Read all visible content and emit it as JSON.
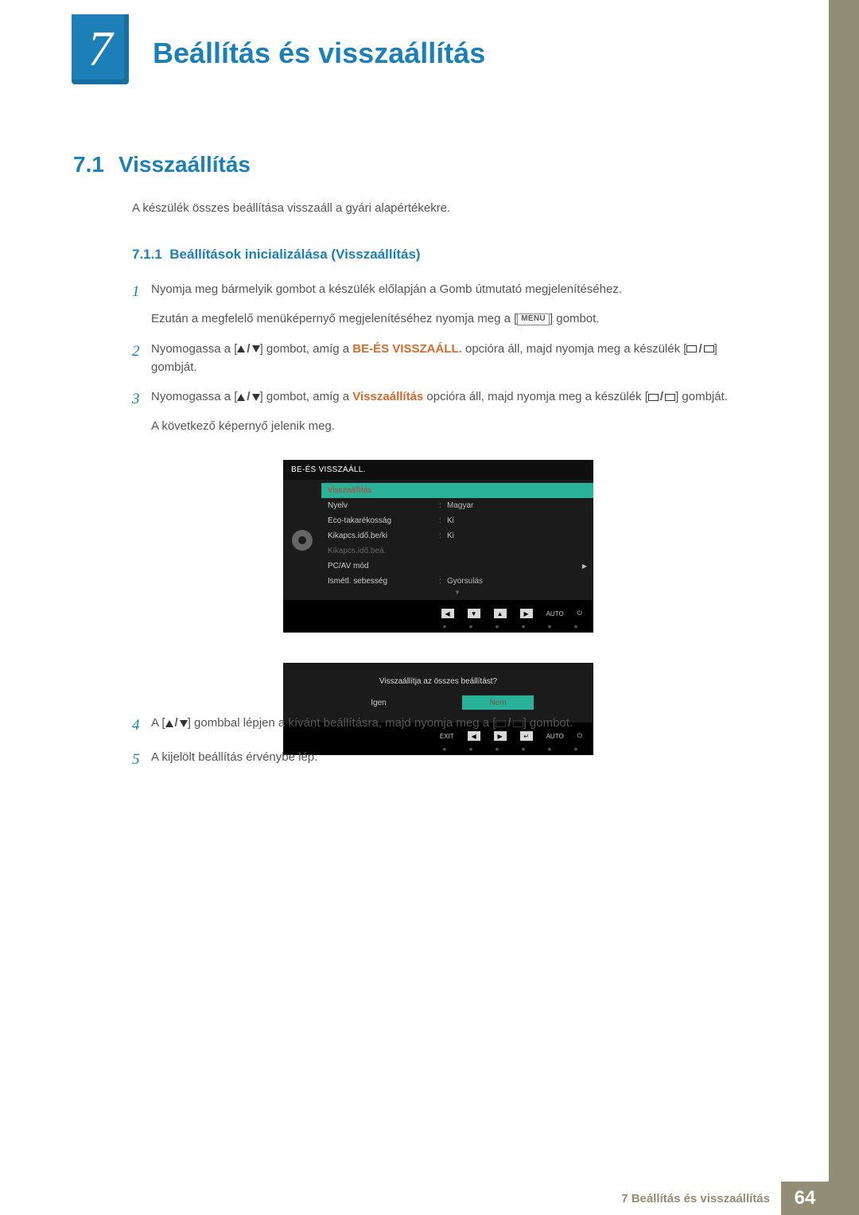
{
  "chapter": {
    "number": "7",
    "title": "Beállítás és visszaállítás"
  },
  "section": {
    "number": "7.1",
    "title": "Visszaállítás"
  },
  "intro": "A készülék összes beállítása visszaáll a gyári alapértékekre.",
  "subsection": {
    "number": "7.1.1",
    "title": "Beállítások inicializálása (Visszaállítás)"
  },
  "steps": {
    "s1": {
      "num": "1",
      "text": "Nyomja meg bármelyik gombot a készülék előlapján a Gomb útmutató megjelenítéséhez.",
      "sub_a": "Ezután a megfelelő menüképernyő megjelenítéséhez nyomja meg a [",
      "menu_label": "MENU",
      "sub_b": "] gombot."
    },
    "s2": {
      "num": "2",
      "pre": "Nyomogassa a [",
      "mid": "] gombot, amíg a ",
      "highlight": "BE-ÉS VISSZAÁLL.",
      "post": " opcióra áll, majd nyomja meg a készülék [",
      "end": "] gombját."
    },
    "s3": {
      "num": "3",
      "pre": "Nyomogassa a [",
      "mid": "] gombot, amíg a ",
      "highlight": "Visszaállítás",
      "post": " opcióra áll, majd nyomja meg a készülék [",
      "end": "] gombját.",
      "after": "A következő képernyő jelenik meg."
    },
    "s4": {
      "num": "4",
      "pre": "A [",
      "mid": "] gombbal lépjen a kívánt beállításra, majd nyomja meg a [",
      "end": "] gombot."
    },
    "s5": {
      "num": "5",
      "text": "A kijelölt beállítás érvénybe lép."
    }
  },
  "osd": {
    "title": "BE-ÉS VISSZAÁLL.",
    "rows": [
      {
        "label": "Visszaállítás",
        "value": "",
        "selected": true
      },
      {
        "label": "Nyelv",
        "value": "Magyar"
      },
      {
        "label": "Eco-takarékosság",
        "value": "Ki"
      },
      {
        "label": "Kikapcs.idő.be/ki",
        "value": "Ki"
      },
      {
        "label": "Kikapcs.idő.beá.",
        "value": "",
        "dim": true
      },
      {
        "label": "PC/AV mód",
        "value": "",
        "arrow": true
      },
      {
        "label": "Ismétl. sebesség",
        "value": "Gyorsulás"
      }
    ],
    "nav_auto": "AUTO"
  },
  "confirm": {
    "question": "Visszaállítja az összes beállítást?",
    "yes": "Igen",
    "no": "Nem",
    "exit": "EXIT",
    "auto": "AUTO"
  },
  "footer": {
    "label": "7 Beállítás és visszaállítás",
    "page": "64"
  }
}
